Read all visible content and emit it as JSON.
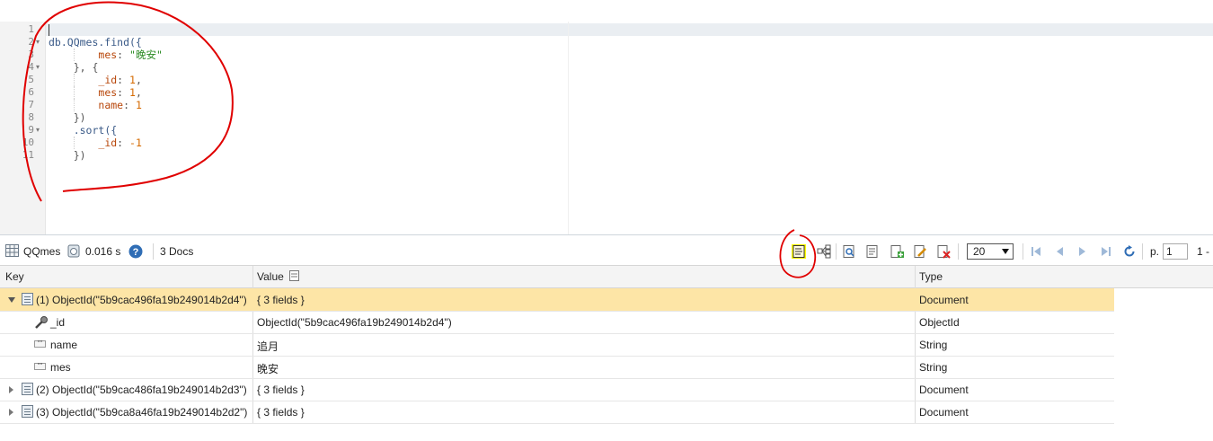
{
  "editor": {
    "line_numbers": [
      "1",
      "2",
      "3",
      "4",
      "5",
      "6",
      "7",
      "8",
      "9",
      "10",
      "11"
    ],
    "code": {
      "l2_obj": "db.QQmes.find({",
      "l3_key": "mes",
      "l3_colon": ": ",
      "l3_val": "\"晚安\"",
      "l4": "}, {",
      "l5_key": "_id",
      "l5_colon": ": ",
      "l5_val": "1",
      "l5_comma": ",",
      "l6_key": "mes",
      "l6_colon": ": ",
      "l6_val": "1",
      "l6_comma": ",",
      "l7_key": "name",
      "l7_colon": ": ",
      "l7_val": "1",
      "l8": "})",
      "l9": ".sort({",
      "l10_key": "_id",
      "l10_colon": ": ",
      "l10_val": "-1",
      "l11": "})"
    }
  },
  "toolbar": {
    "collection": "QQmes",
    "time": "0.016 s",
    "docs": "3 Docs",
    "page_size": "20",
    "page_label": "p.",
    "page_value": "1",
    "range": "1 -"
  },
  "grid": {
    "headers": {
      "key": "Key",
      "value": "Value",
      "type": "Type"
    },
    "rows": [
      {
        "key": "(1) ObjectId(\"5b9cac496fa19b249014b2d4\")",
        "value": "{ 3 fields }",
        "type": "Document"
      },
      {
        "key": "_id",
        "value": "ObjectId(\"5b9cac496fa19b249014b2d4\")",
        "type": "ObjectId"
      },
      {
        "key": "name",
        "value": "追月",
        "type": "String"
      },
      {
        "key": "mes",
        "value": "晚安",
        "type": "String"
      },
      {
        "key": "(2) ObjectId(\"5b9cac486fa19b249014b2d3\")",
        "value": "{ 3 fields }",
        "type": "Document"
      },
      {
        "key": "(3) ObjectId(\"5b9ca8a46fa19b249014b2d2\")",
        "value": "{ 3 fields }",
        "type": "Document"
      }
    ]
  },
  "colors": {
    "selected_row": "#fde5a6",
    "annotation": "#e00000",
    "highlight": "#ffff00"
  }
}
